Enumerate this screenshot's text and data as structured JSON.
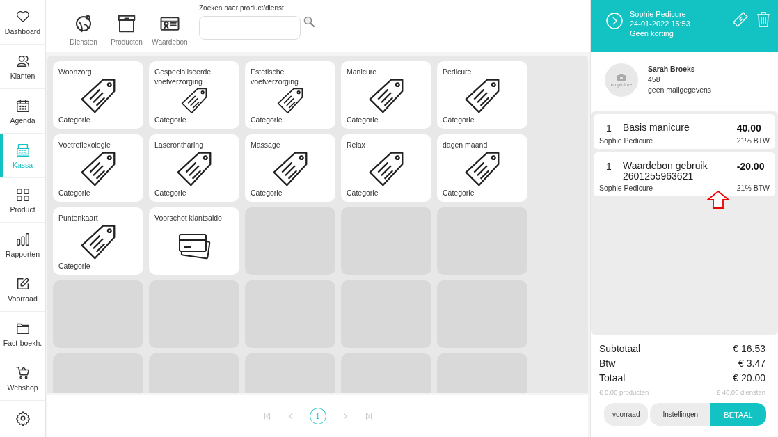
{
  "sidebar": {
    "items": [
      {
        "kind": "heart",
        "label": "Dashboard",
        "selected": false
      },
      {
        "kind": "people",
        "label": "Klanten",
        "selected": false
      },
      {
        "kind": "calendar",
        "label": "Agenda",
        "selected": false
      },
      {
        "kind": "register",
        "label": "Kassa",
        "selected": true
      },
      {
        "kind": "grid",
        "label": "Product",
        "selected": false
      },
      {
        "kind": "bars",
        "label": "Rapporten",
        "selected": false
      },
      {
        "kind": "edit",
        "label": "Voorraad",
        "selected": false
      },
      {
        "kind": "folder",
        "label": "Fact-boekh.",
        "selected": false
      },
      {
        "kind": "cart",
        "label": "Webshop",
        "selected": false
      },
      {
        "kind": "gear",
        "selected": false
      }
    ]
  },
  "toolbar": {
    "tabs": [
      {
        "kind": "service",
        "label": "Diensten"
      },
      {
        "kind": "box",
        "label": "Producten"
      },
      {
        "kind": "voucher",
        "label": "Waardebon"
      }
    ],
    "search": {
      "label": "Zoeken naar product/dienst"
    }
  },
  "tiles": [
    {
      "kind": "category",
      "title": "Woonzorg",
      "caption": "Categorie"
    },
    {
      "kind": "category",
      "title": "Gespecialiseerde voetverzorging",
      "caption": "Categorie"
    },
    {
      "kind": "category",
      "title": "Estetische voetverzorging",
      "caption": "Categorie"
    },
    {
      "kind": "category",
      "title": "Manicure",
      "caption": "Categorie"
    },
    {
      "kind": "category",
      "title": "Pedicure",
      "caption": "Categorie"
    },
    {
      "kind": "category",
      "title": "Voetreflexologie",
      "caption": "Categorie"
    },
    {
      "kind": "category",
      "title": "Laserontharing",
      "caption": "Categorie"
    },
    {
      "kind": "category",
      "title": "Massage",
      "caption": "Categorie"
    },
    {
      "kind": "category",
      "title": "Relax",
      "caption": "Categorie"
    },
    {
      "kind": "category",
      "title": "dagen maand",
      "caption": "Categorie"
    },
    {
      "kind": "category",
      "title": "Puntenkaart",
      "caption": "Categorie"
    },
    {
      "kind": "card",
      "title": "Voorschot klantsaldo"
    },
    {
      "kind": "empty"
    },
    {
      "kind": "empty"
    },
    {
      "kind": "empty"
    },
    {
      "kind": "empty"
    },
    {
      "kind": "empty"
    },
    {
      "kind": "empty"
    },
    {
      "kind": "empty"
    },
    {
      "kind": "empty"
    },
    {
      "kind": "empty"
    },
    {
      "kind": "empty"
    },
    {
      "kind": "empty"
    },
    {
      "kind": "empty"
    },
    {
      "kind": "empty"
    }
  ],
  "pagination": {
    "nav": [
      {
        "kind": "first",
        "disabled": true
      },
      {
        "kind": "prev",
        "disabled": true
      },
      {
        "kind": "next",
        "disabled": true
      },
      {
        "kind": "last",
        "disabled": true
      }
    ],
    "pages": [
      {
        "label": "1",
        "selected": true
      }
    ]
  },
  "order": {
    "header": {
      "employee": "Sophie Pedicure",
      "datetime": "24-01-2022 15:53",
      "discount": "Geen korting"
    },
    "customer": {
      "photo_label": "no picture",
      "name": "Sarah Broeks",
      "number": "458",
      "email": "geen mailgegevens"
    },
    "lines": [
      {
        "qty": "1",
        "name": "Basis manicure",
        "price": "40.00",
        "employee": "Sophie Pedicure",
        "vat": "21% BTW"
      },
      {
        "qty": "1",
        "name": "Waardebon gebruik",
        "code": "2601255963621",
        "price": "-20.00",
        "employee": "Sophie Pedicure",
        "vat": "21% BTW"
      }
    ],
    "totals": [
      {
        "label": "Subtotaal",
        "value": "€ 16.53"
      },
      {
        "label": "Btw",
        "value": "€ 3.47"
      },
      {
        "label": "Totaal",
        "value": "€ 20.00"
      }
    ],
    "products_total": "€ 0.00 producten",
    "services_total": "€ 40.00 diensten",
    "buttons": [
      {
        "kind": "secondary",
        "label": "voorraad"
      },
      {
        "kind": "secondary",
        "label": "Instellingen"
      },
      {
        "kind": "primary",
        "label": "BETAAL"
      }
    ]
  }
}
